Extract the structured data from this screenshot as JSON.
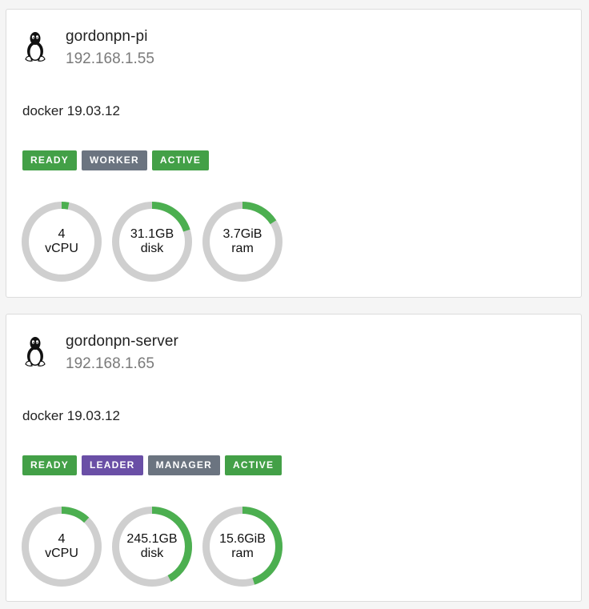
{
  "colors": {
    "gauge_track": "#cfcfcf",
    "gauge_fill": "#4caf50",
    "ready": "#43a047",
    "active": "#43a047",
    "worker": "#6b7480",
    "manager": "#6b7480",
    "leader": "#6a4fa6"
  },
  "nodes": [
    {
      "os_icon": "linux-tux-icon",
      "name": "gordonpn-pi",
      "ip": "192.168.1.55",
      "engine": "docker 19.03.12",
      "badges": [
        "READY",
        "WORKER",
        "ACTIVE"
      ],
      "gauges": [
        {
          "value": "4",
          "unit": "vCPU",
          "fraction": 0.03
        },
        {
          "value": "31.1GB",
          "unit": "disk",
          "fraction": 0.2
        },
        {
          "value": "3.7GiB",
          "unit": "ram",
          "fraction": 0.16
        }
      ]
    },
    {
      "os_icon": "linux-tux-icon",
      "name": "gordonpn-server",
      "ip": "192.168.1.65",
      "engine": "docker 19.03.12",
      "badges": [
        "READY",
        "LEADER",
        "MANAGER",
        "ACTIVE"
      ],
      "gauges": [
        {
          "value": "4",
          "unit": "vCPU",
          "fraction": 0.12
        },
        {
          "value": "245.1GB",
          "unit": "disk",
          "fraction": 0.42
        },
        {
          "value": "15.6GiB",
          "unit": "ram",
          "fraction": 0.45
        }
      ]
    }
  ]
}
